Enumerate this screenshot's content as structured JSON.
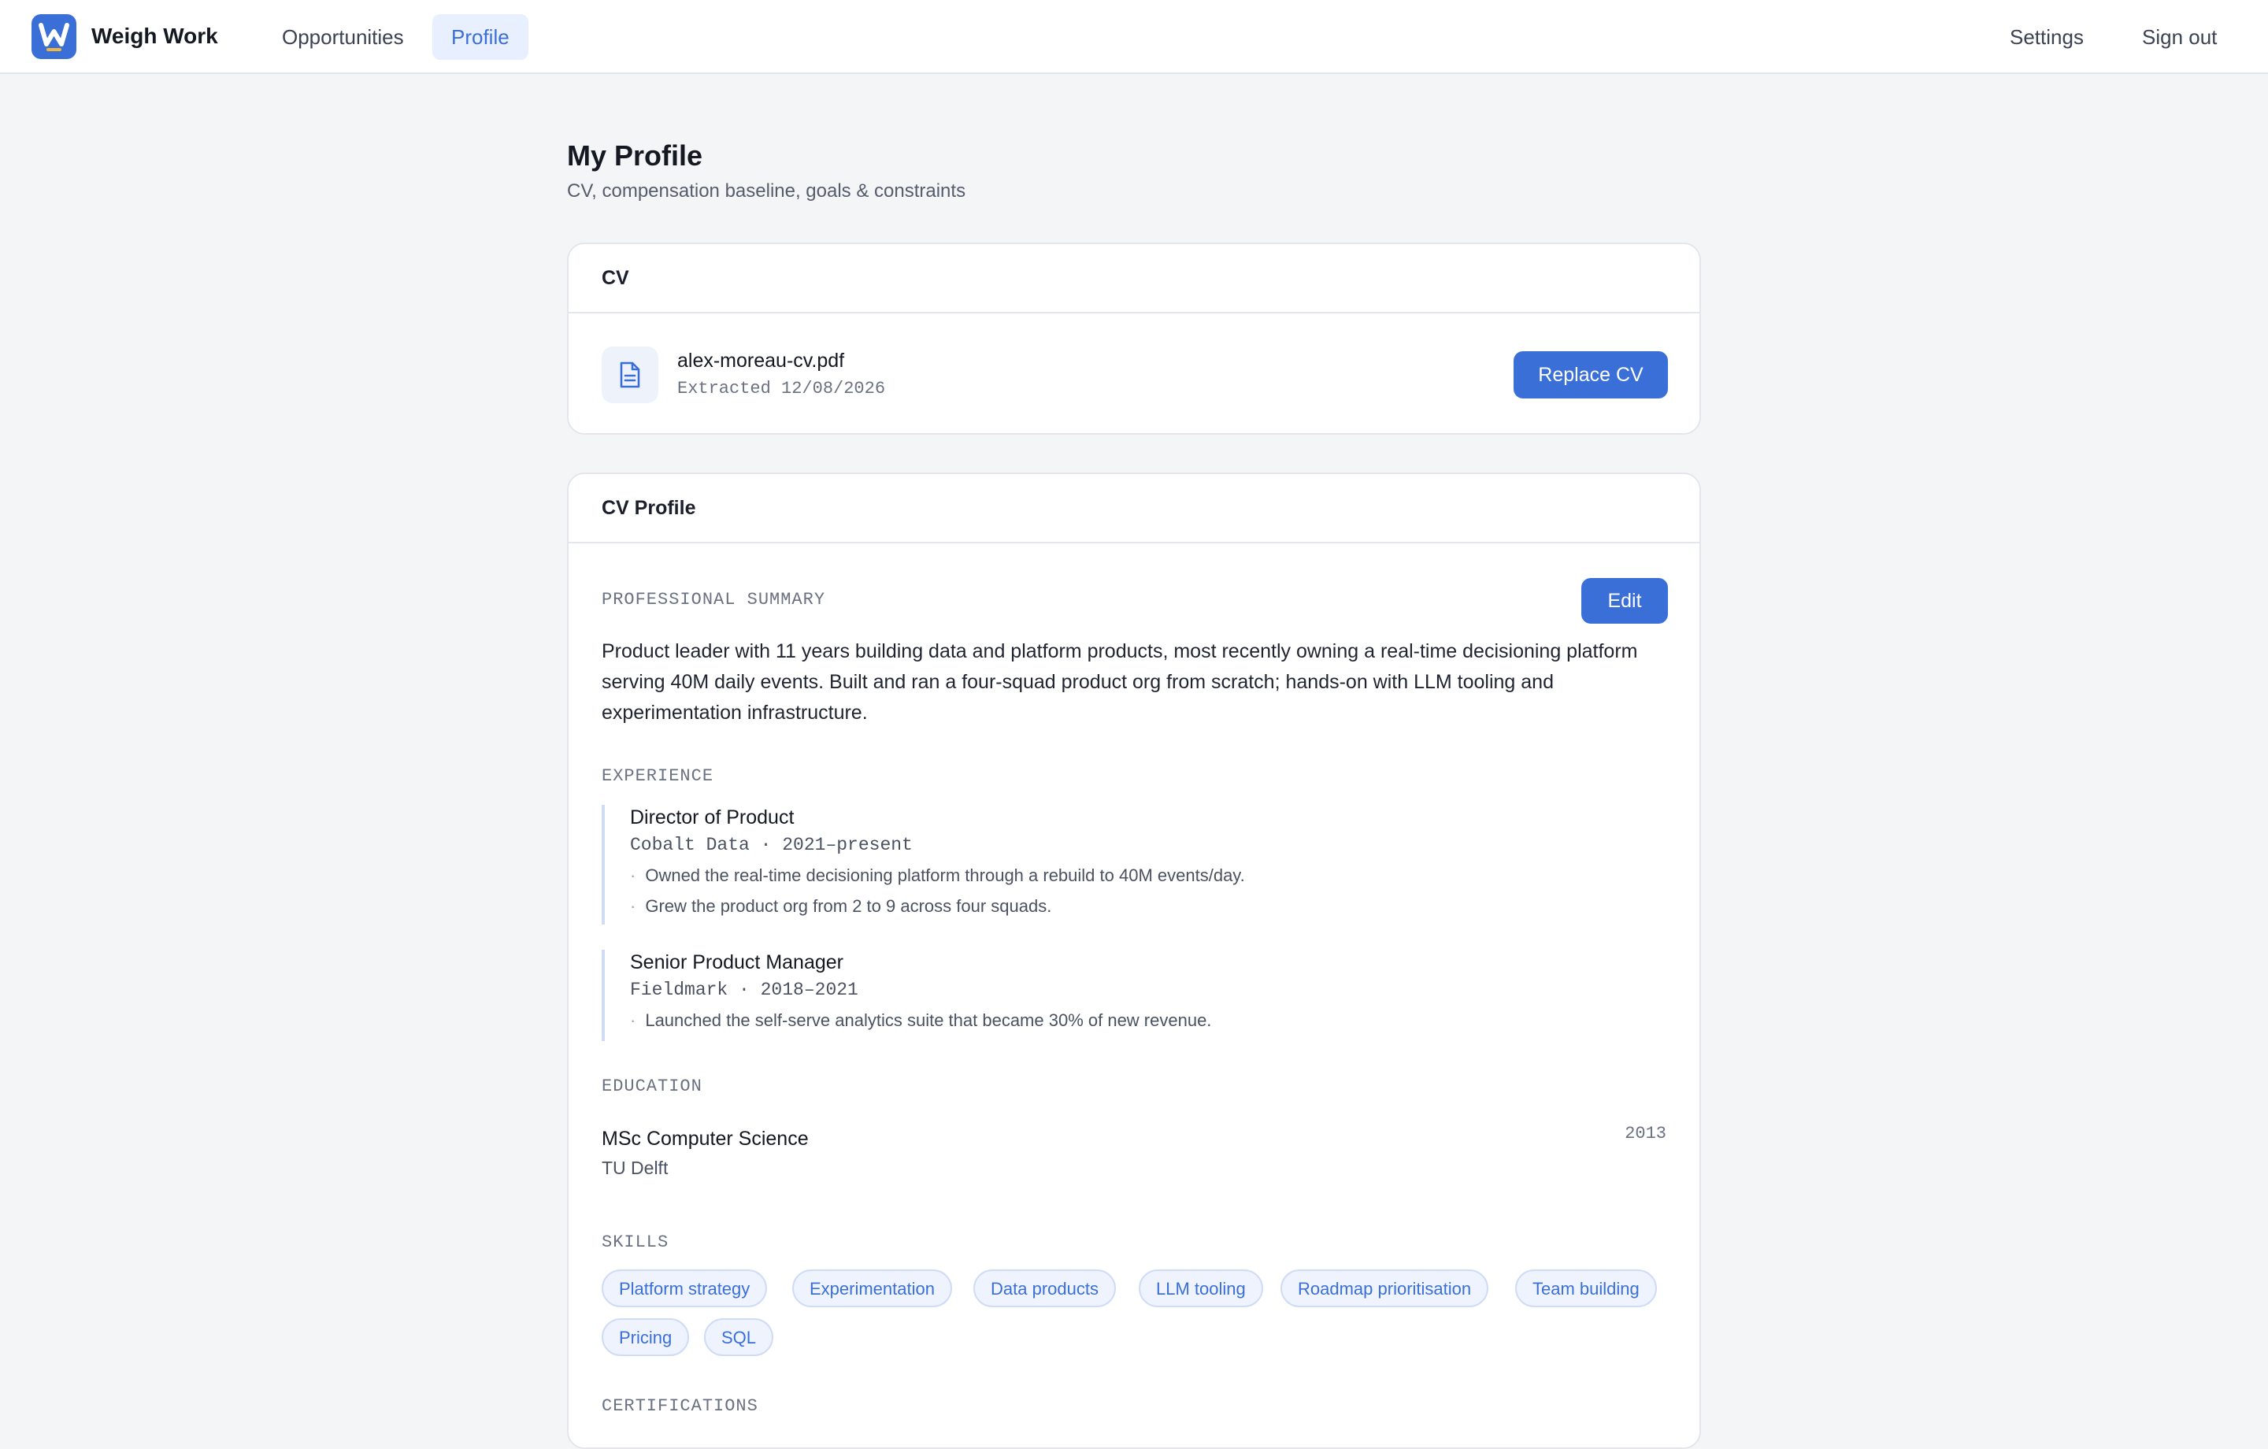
{
  "app": {
    "brand": "Weigh Work",
    "accent": "#3a6fd8"
  },
  "nav": {
    "items": [
      {
        "label": "Opportunities",
        "active": false
      },
      {
        "label": "Profile",
        "active": true
      }
    ],
    "settings_label": "Settings",
    "signout_label": "Sign out"
  },
  "page": {
    "title": "My Profile",
    "subtitle": "CV, compensation baseline, goals & constraints"
  },
  "cv_card": {
    "title": "CV",
    "file_name": "alex-moreau-cv.pdf",
    "file_meta": "Extracted 12/08/2026",
    "replace_label": "Replace CV",
    "icon": "document-icon"
  },
  "cv_profile": {
    "title": "CV Profile",
    "edit_label": "Edit",
    "summary_label": "PROFESSIONAL SUMMARY",
    "summary": "Product leader with 11 years building data and platform products, most recently owning a real-time decisioning platform serving 40M daily events. Built and ran a four-squad product org from scratch; hands-on with LLM tooling and experimentation infrastructure.",
    "experience_label": "EXPERIENCE",
    "experience": [
      {
        "role": "Director of Product",
        "meta": "Cobalt Data · 2021–present",
        "bullets": [
          "Owned the real-time decisioning platform through a rebuild to 40M events/day.",
          "Grew the product org from 2 to 9 across four squads."
        ]
      },
      {
        "role": "Senior Product Manager",
        "meta": "Fieldmark · 2018–2021",
        "bullets": [
          "Launched the self-serve analytics suite that became 30% of new revenue."
        ]
      }
    ],
    "education_label": "EDUCATION",
    "education": [
      {
        "degree": "MSc Computer Science",
        "school": "TU Delft",
        "year": "2013"
      }
    ],
    "skills_label": "SKILLS",
    "skills": [
      "Platform strategy",
      "Experimentation",
      "Data products",
      "LLM tooling",
      "Roadmap prioritisation",
      "Team building",
      "Pricing",
      "SQL"
    ],
    "certifications_label": "CERTIFICATIONS"
  }
}
